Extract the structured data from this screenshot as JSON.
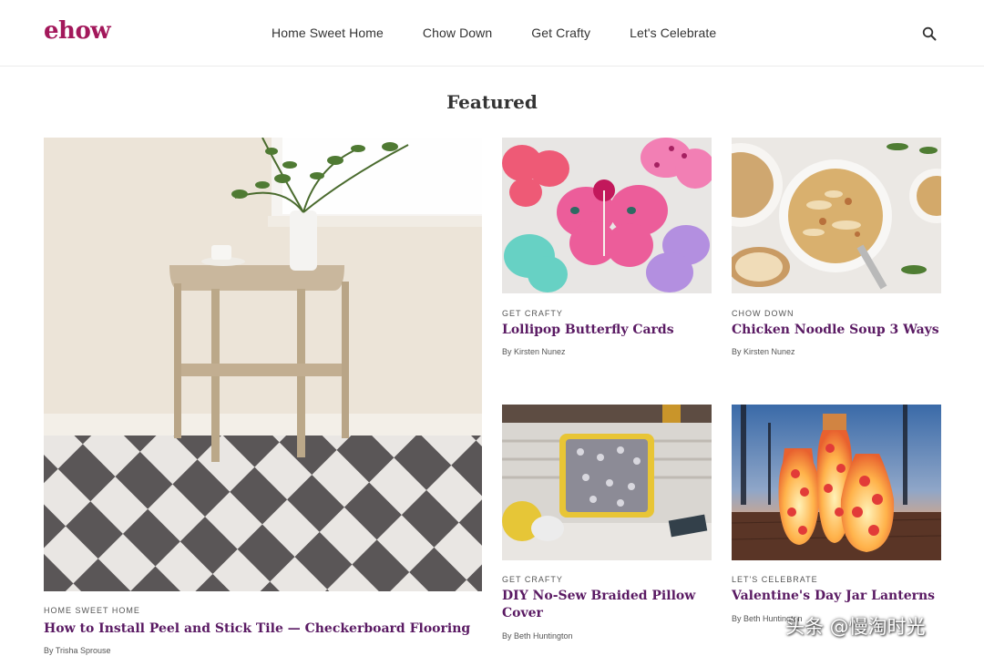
{
  "header": {
    "logo": "ehow",
    "nav": [
      "Home Sweet Home",
      "Chow Down",
      "Get Crafty",
      "Let's Celebrate"
    ],
    "search_icon": "search-icon"
  },
  "section_title": "Featured",
  "cards": [
    {
      "category": "HOME SWEET HOME",
      "title": "How to Install Peel and Stick Tile — Checkerboard Flooring",
      "byline": "By Trisha Sprouse"
    },
    {
      "category": "GET CRAFTY",
      "title": "Lollipop Butterfly Cards",
      "byline": "By Kirsten Nunez"
    },
    {
      "category": "CHOW DOWN",
      "title": "Chicken Noodle Soup 3 Ways",
      "byline": "By Kirsten Nunez"
    },
    {
      "category": "GET CRAFTY",
      "title": "DIY No-Sew Braided Pillow Cover",
      "byline": "By Beth Huntington"
    },
    {
      "category": "LET'S CELEBRATE",
      "title": "Valentine's Day Jar Lanterns",
      "byline": "By Beth Huntington"
    }
  ],
  "watermark": "头条 @慢淘时光",
  "colors": {
    "brand": "#a3185b",
    "title": "#5a1a63"
  }
}
